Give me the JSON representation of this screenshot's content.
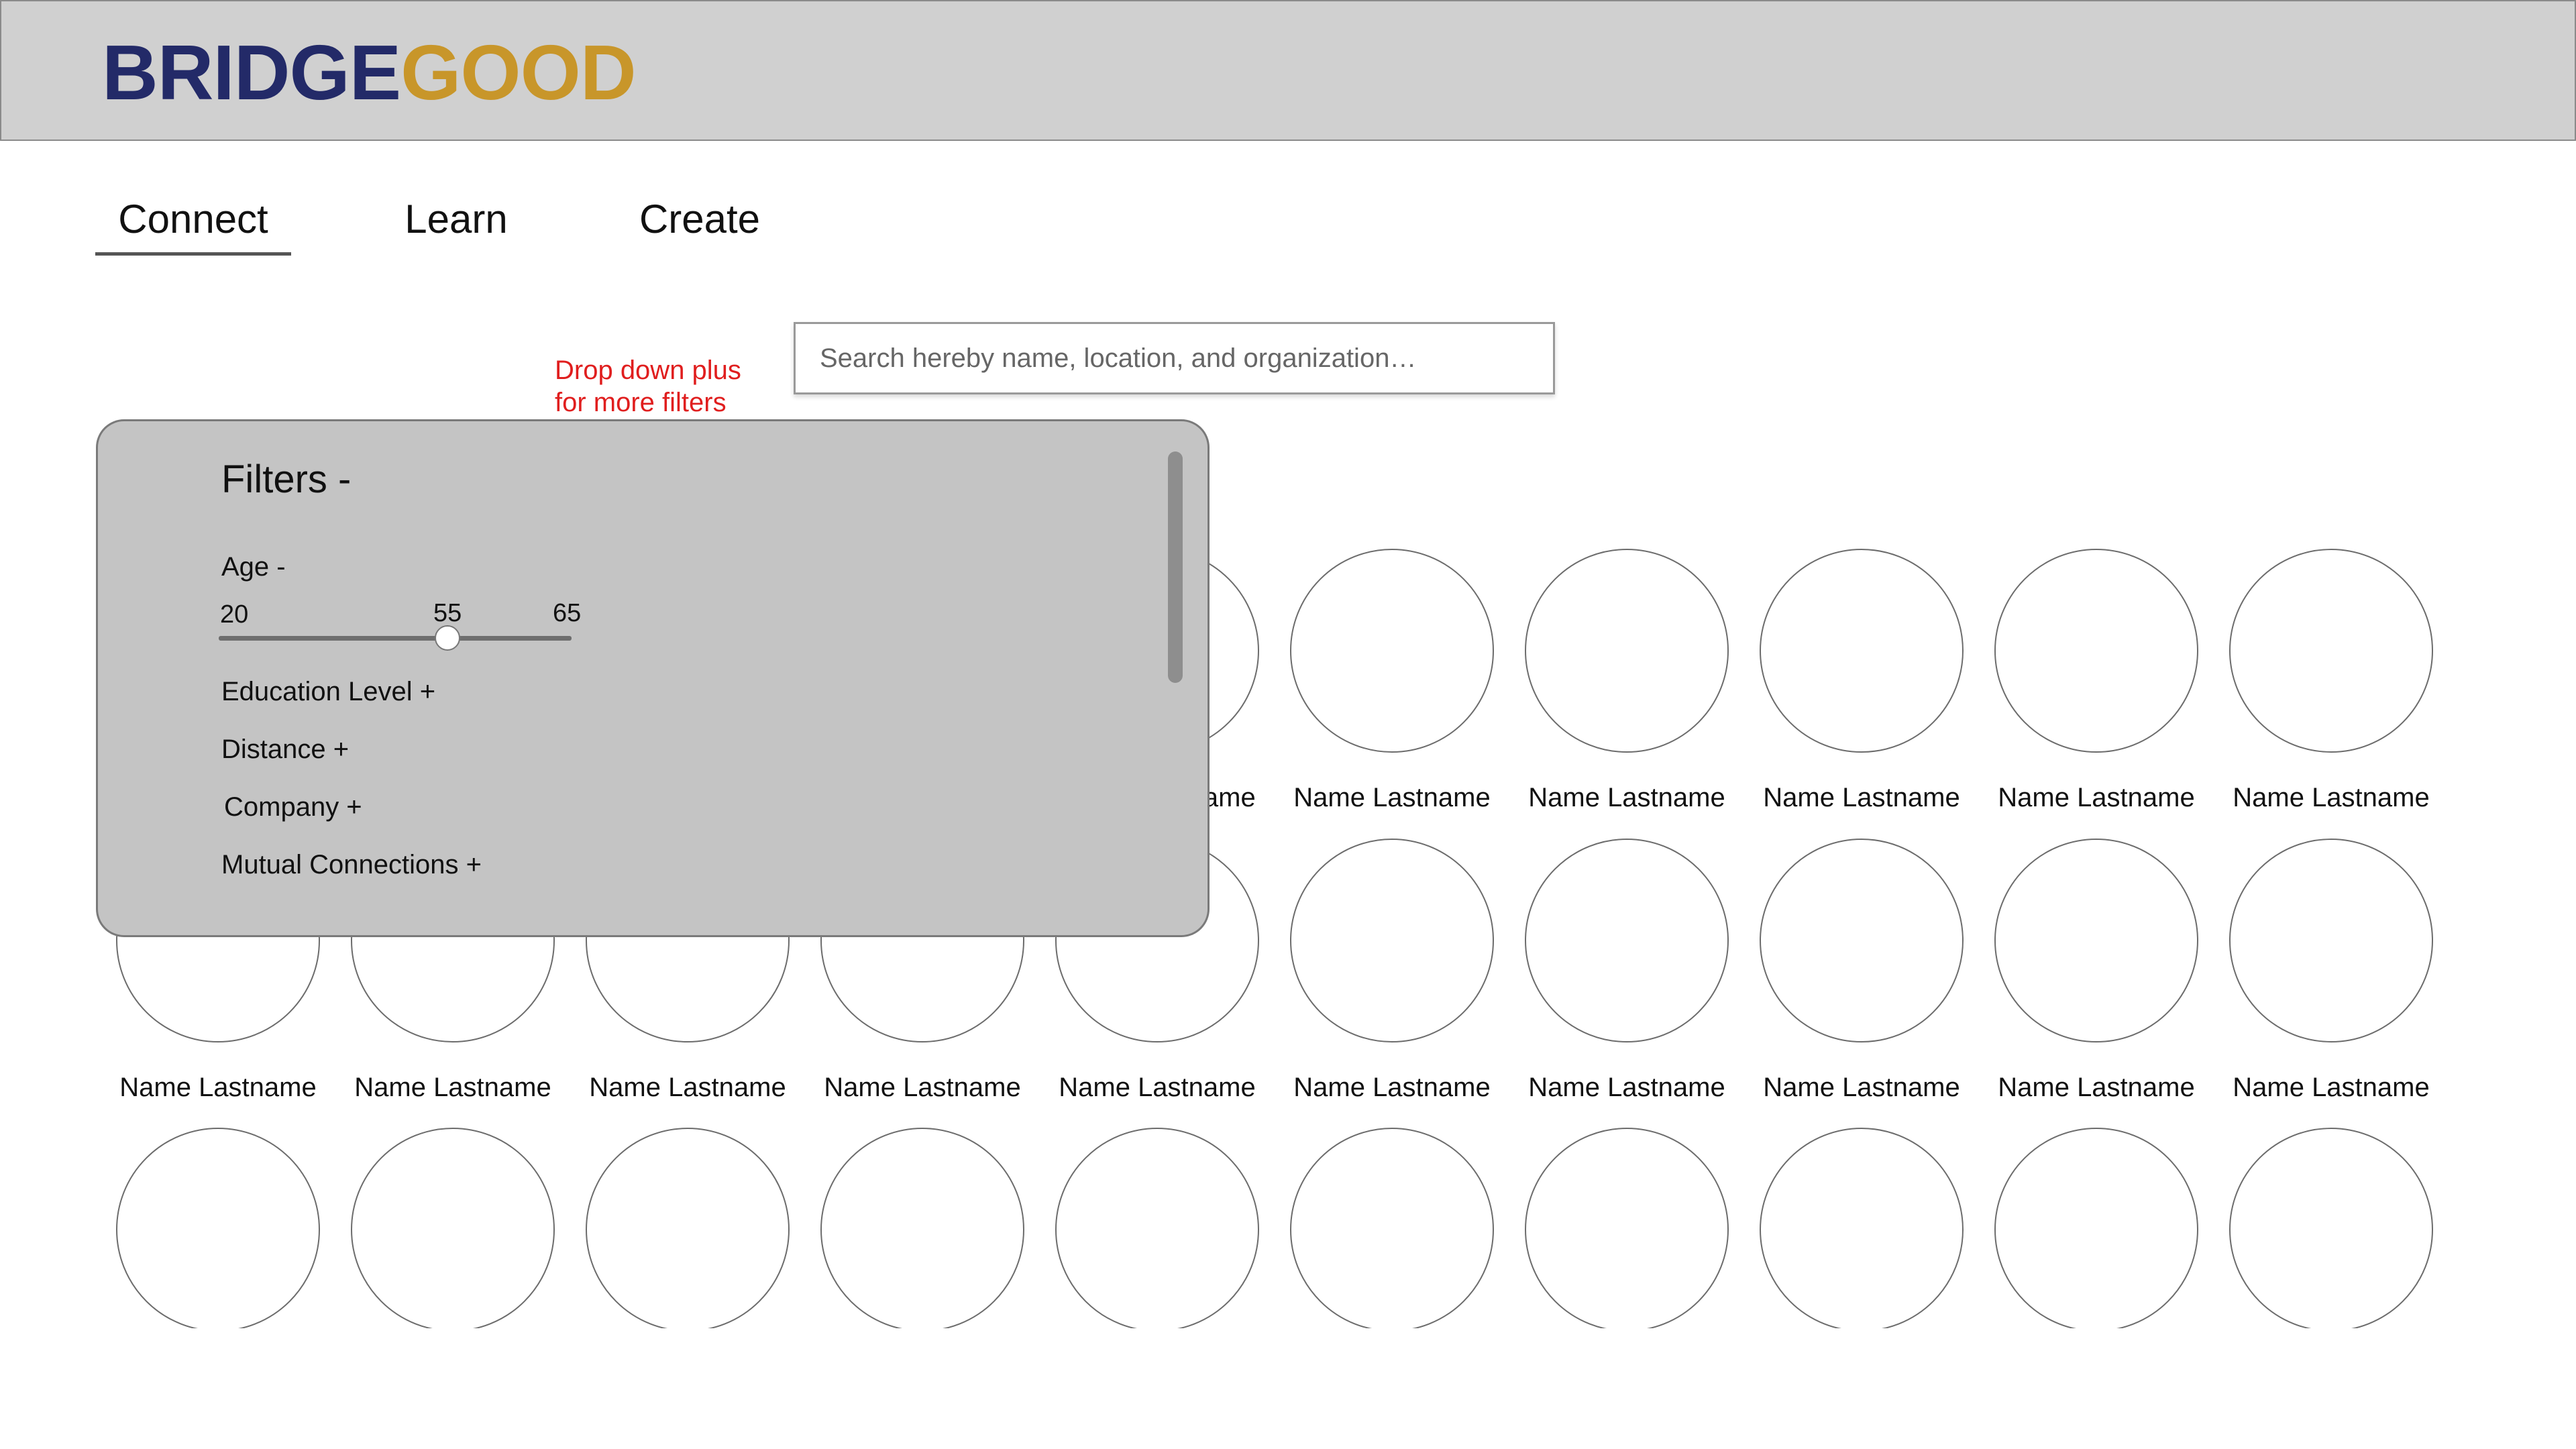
{
  "brand": {
    "part1": "BRIDGE",
    "part2": "GOOD"
  },
  "nav": {
    "tabs": [
      {
        "label": "Connect"
      },
      {
        "label": "Learn"
      },
      {
        "label": "Create"
      }
    ]
  },
  "annotation": {
    "line1": "Drop down plus",
    "line2": "for more filters"
  },
  "search": {
    "placeholder": "Search hereby name, location, and organization…",
    "value": ""
  },
  "filters": {
    "title": "Filters -",
    "age": {
      "label": "Age -",
      "min": "20",
      "current": "55",
      "max": "65"
    },
    "sections": [
      {
        "label": "Education Level +"
      },
      {
        "label": "Distance +"
      },
      {
        "label": "Company +"
      },
      {
        "label": "Mutual Connections +"
      }
    ]
  },
  "people": {
    "row1": [
      "Name Lastname",
      "Name Lastname",
      "Name Lastname",
      "Name Lastname",
      "Name Lastname",
      "Name Lastname",
      "Name Lastname",
      "Name Lastname",
      "Name Lastname",
      "Name Lastname"
    ],
    "row2": [
      "Name Lastname",
      "Name Lastname",
      "Name Lastname",
      "Name Lastname",
      "Name Lastname",
      "Name Lastname",
      "Name Lastname",
      "Name Lastname",
      "Name Lastname",
      "Name Lastname"
    ],
    "row3_count": 10
  },
  "colors": {
    "brand_navy": "#232a68",
    "brand_gold": "#c8962a",
    "annotation_red": "#e01e1e"
  }
}
